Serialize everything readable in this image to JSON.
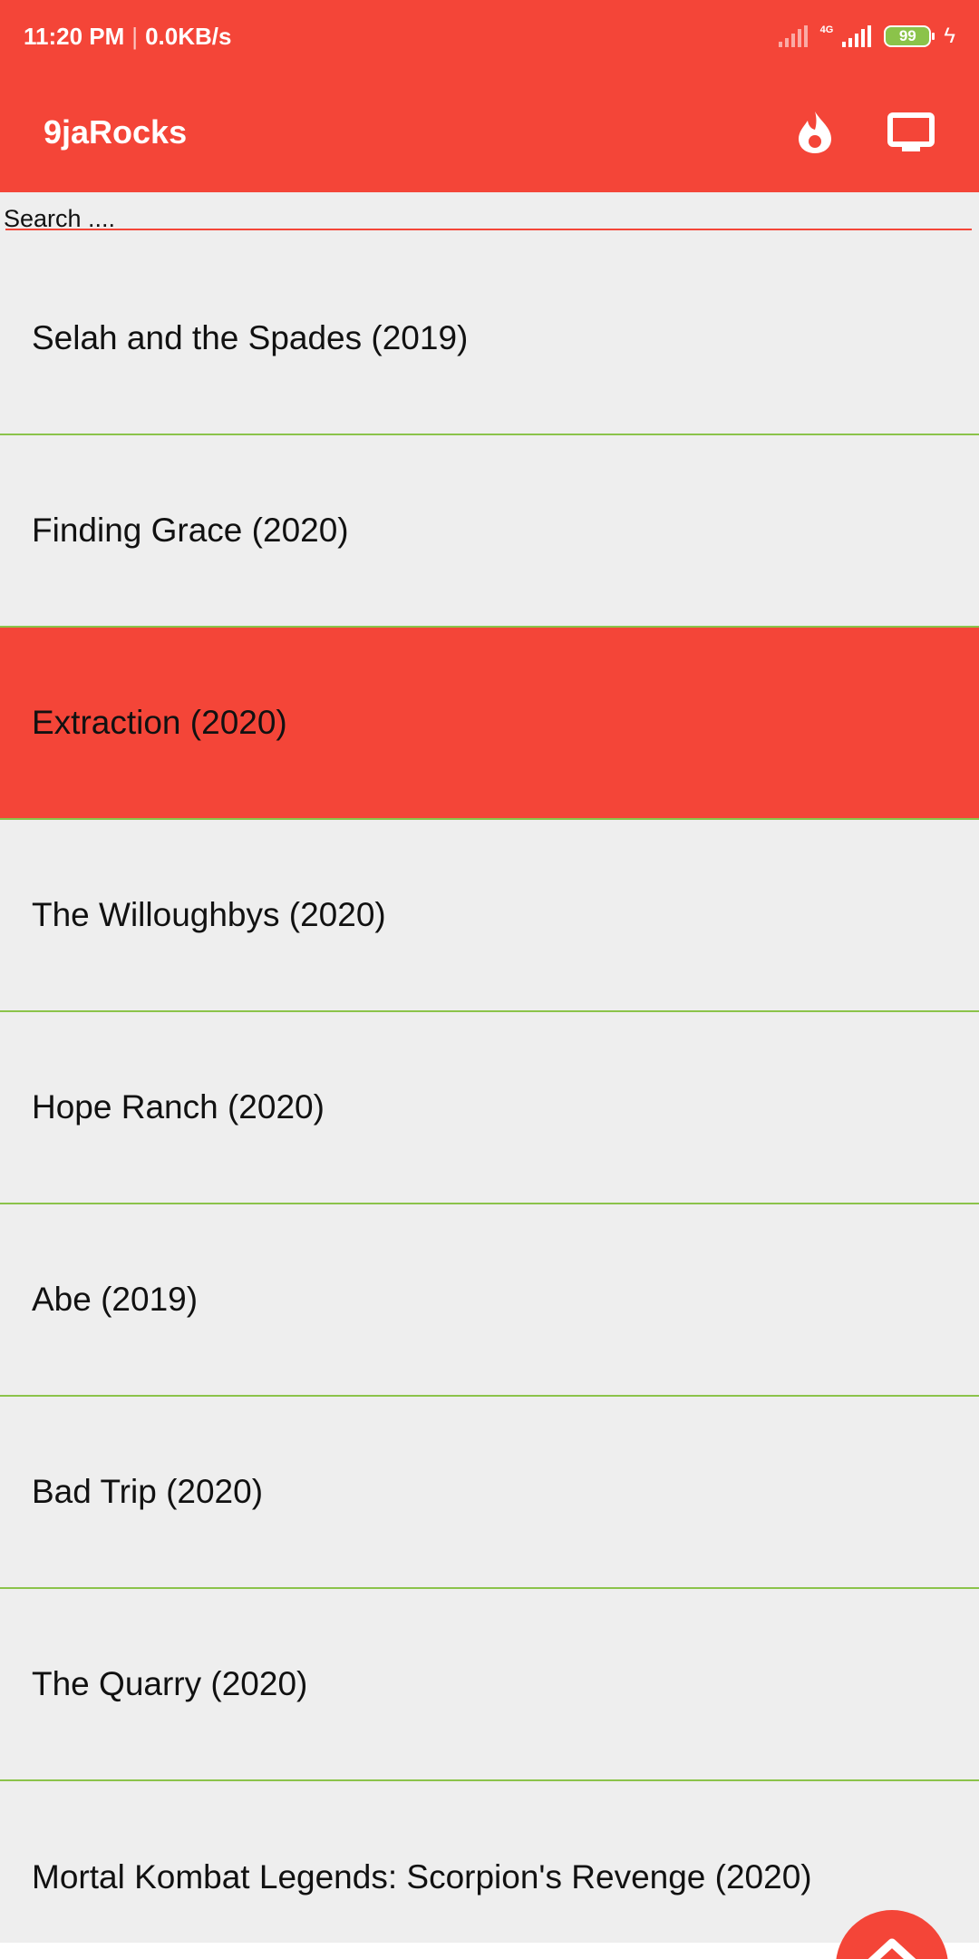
{
  "status_bar": {
    "time": "11:20 PM",
    "separator": "|",
    "speed": "0.0KB/s",
    "network": "4G",
    "battery": "99"
  },
  "toolbar": {
    "title": "9jaRocks",
    "icons": [
      "flame-icon",
      "tv-icon"
    ]
  },
  "search": {
    "placeholder": "Search ...."
  },
  "colors": {
    "accent": "#f44538",
    "divider": "#8bc34a",
    "background": "#eeeeee"
  },
  "movies": [
    {
      "title": "Selah and the Spades (2019)",
      "selected": false
    },
    {
      "title": "Finding Grace (2020)",
      "selected": false
    },
    {
      "title": "Extraction (2020)",
      "selected": true
    },
    {
      "title": "The Willoughbys (2020)",
      "selected": false
    },
    {
      "title": "Hope Ranch (2020)",
      "selected": false
    },
    {
      "title": "Abe (2019)",
      "selected": false
    },
    {
      "title": "Bad Trip (2020)",
      "selected": false
    },
    {
      "title": "The Quarry (2020)",
      "selected": false
    },
    {
      "title": "Mortal Kombat Legends: Scorpion's Revenge (2020)",
      "selected": false
    }
  ],
  "fab": {
    "icon": "chevron-up-icon"
  }
}
